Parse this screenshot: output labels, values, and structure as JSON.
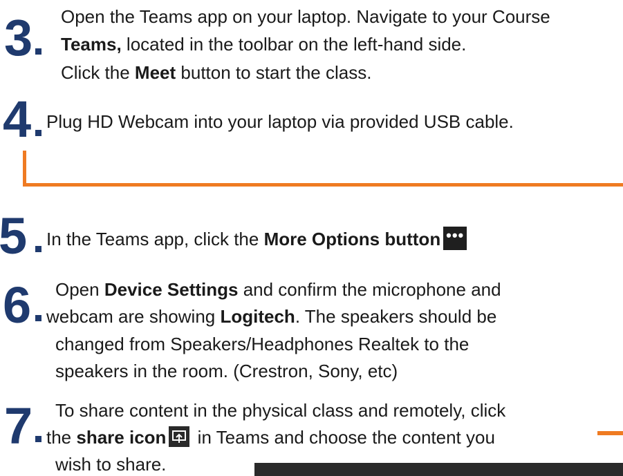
{
  "steps": {
    "s3": {
      "number": "3",
      "line1": "Open the Teams app on your laptop. Navigate to your Course",
      "line2_bold": "Teams,",
      "line2_rest": " located in the toolbar on the left-hand side.",
      "line3_pre": "Click the ",
      "line3_bold": "Meet",
      "line3_post": " button to start the class."
    },
    "s4": {
      "number": "4",
      "line1": "Plug HD Webcam into your laptop via provided USB cable."
    },
    "s5": {
      "number": "5",
      "line1_pre": "In the Teams app, click the ",
      "line1_bold": "More Options button",
      "button_glyph": "•••"
    },
    "s6": {
      "number": "6",
      "line1_pre": "Open ",
      "line1_bold": "Device Settings",
      "line1_post": " and confirm the microphone and",
      "line2_pre": "webcam are showing ",
      "line2_bold": "Logitech",
      "line2_post": ". The speakers should be",
      "line3": "changed from Speakers/Headphones Realtek to the",
      "line4": "speakers in the room. (Crestron, Sony, etc)"
    },
    "s7": {
      "number": "7",
      "line1": "To share content in the physical class and remotely, click",
      "line2_pre": "the ",
      "line2_bold": "share icon",
      "line2_post": " in Teams and choose the content you",
      "line3": "wish to share."
    }
  },
  "colors": {
    "number": "#1f3a6e",
    "accent": "#ef7b22",
    "dark": "#2a2a2a"
  }
}
